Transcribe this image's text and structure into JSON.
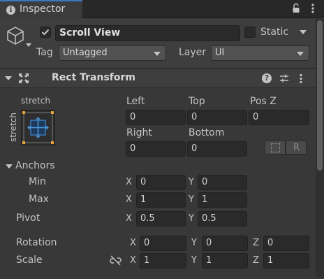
{
  "tab": {
    "title": "Inspector"
  },
  "header": {
    "object_name": "Scroll View",
    "static_label": "Static",
    "tag_label": "Tag",
    "tag_value": "Untagged",
    "layer_label": "Layer",
    "layer_value": "UI"
  },
  "rect_transform": {
    "title": "Rect Transform",
    "anchor_preset_top": "stretch",
    "anchor_preset_side": "stretch",
    "left_label": "Left",
    "left_value": "0",
    "top_label": "Top",
    "top_value": "0",
    "posz_label": "Pos Z",
    "posz_value": "0",
    "right_label": "Right",
    "right_value": "0",
    "bottom_label": "Bottom",
    "bottom_value": "0",
    "anchors_label": "Anchors",
    "min_label": "Min",
    "min_x": "0",
    "min_y": "0",
    "max_label": "Max",
    "max_x": "1",
    "max_y": "1",
    "pivot_label": "Pivot",
    "pivot_x": "0.5",
    "pivot_y": "0.5",
    "rotation_label": "Rotation",
    "rot_x": "0",
    "rot_y": "0",
    "rot_z": "0",
    "scale_label": "Scale",
    "scale_x": "1",
    "scale_y": "1",
    "scale_z": "1",
    "raw_button": "R",
    "axis_x": "X",
    "axis_y": "Y",
    "axis_z": "Z"
  },
  "colors": {
    "background": "#383838",
    "accent": "#3a79bb",
    "anchor_orange": "#e8a33a"
  }
}
